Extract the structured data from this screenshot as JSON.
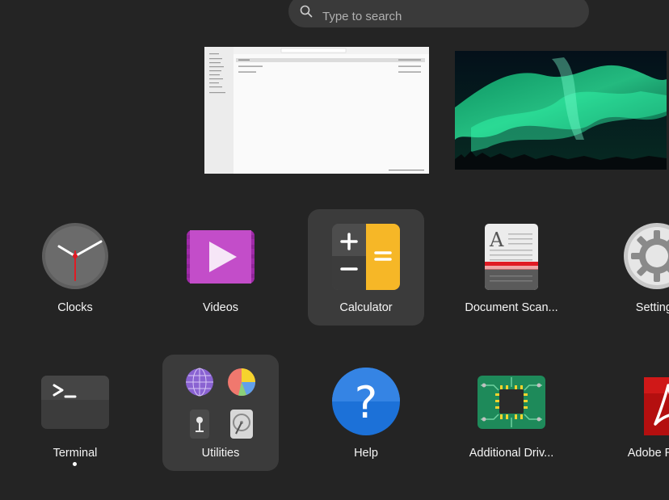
{
  "search": {
    "placeholder": "Type to search"
  },
  "workspaces": [
    {
      "name": "Files window"
    },
    {
      "name": "Aurora wallpaper"
    }
  ],
  "apps_row1": [
    {
      "label": "Clocks",
      "icon": "clock-icon"
    },
    {
      "label": "Videos",
      "icon": "video-play-icon"
    },
    {
      "label": "Calculator",
      "icon": "calculator-icon",
      "selected": true
    },
    {
      "label": "Document Scan...",
      "icon": "document-scanner-icon"
    },
    {
      "label": "Settings",
      "icon": "gear-icon"
    }
  ],
  "apps_row2": [
    {
      "label": "Terminal",
      "icon": "terminal-icon",
      "running": true
    },
    {
      "label": "Utilities",
      "icon": "folder-icon",
      "selected": true
    },
    {
      "label": "Help",
      "icon": "help-icon"
    },
    {
      "label": "Additional Driv...",
      "icon": "chip-icon"
    },
    {
      "label": "Adobe Rea",
      "icon": "adobe-reader-icon"
    }
  ],
  "colors": {
    "background": "#242424",
    "search_bg": "#3a3a3a",
    "selected_tile": "#3b3b3b"
  }
}
